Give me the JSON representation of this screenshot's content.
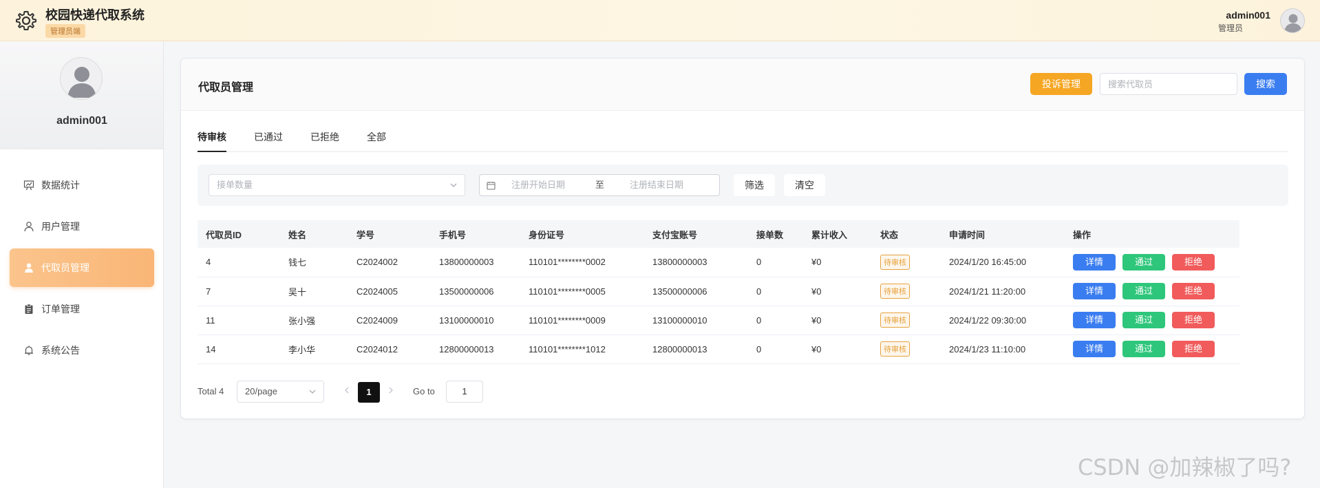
{
  "header": {
    "app_title": "校园快递代取系统",
    "role_badge": "管理员端",
    "user_name": "admin001",
    "user_role": "管理员"
  },
  "sidebar": {
    "profile_name": "admin001",
    "items": [
      {
        "label": "数据统计",
        "icon": "presentation-chart-icon",
        "active": false
      },
      {
        "label": "用户管理",
        "icon": "user-icon",
        "active": false
      },
      {
        "label": "代取员管理",
        "icon": "user-filled-icon",
        "active": true
      },
      {
        "label": "订单管理",
        "icon": "clipboard-icon",
        "active": false
      },
      {
        "label": "系统公告",
        "icon": "bell-icon",
        "active": false
      }
    ]
  },
  "main": {
    "title": "代取员管理",
    "complaint_button": "投诉管理",
    "search_placeholder": "搜索代取员",
    "search_button": "搜索",
    "tabs": [
      {
        "label": "待审核",
        "active": true
      },
      {
        "label": "已通过",
        "active": false
      },
      {
        "label": "已拒绝",
        "active": false
      },
      {
        "label": "全部",
        "active": false
      }
    ],
    "filter": {
      "order_count_placeholder": "接单数量",
      "date_start_placeholder": "注册开始日期",
      "date_separator": "至",
      "date_end_placeholder": "注册结束日期",
      "filter_button": "筛选",
      "clear_button": "清空"
    },
    "table": {
      "columns": [
        "代取员ID",
        "姓名",
        "学号",
        "手机号",
        "身份证号",
        "支付宝账号",
        "接单数",
        "累计收入",
        "状态",
        "申请时间",
        "操作"
      ],
      "rows": [
        {
          "id": "4",
          "name": "钱七",
          "student_no": "C2024002",
          "phone": "13800000003",
          "id_card": "110101********0002",
          "alipay": "13800000003",
          "orders": "0",
          "income": "¥0",
          "status": "待审核",
          "apply_time": "2024/1/20 16:45:00"
        },
        {
          "id": "7",
          "name": "吴十",
          "student_no": "C2024005",
          "phone": "13500000006",
          "id_card": "110101********0005",
          "alipay": "13500000006",
          "orders": "0",
          "income": "¥0",
          "status": "待审核",
          "apply_time": "2024/1/21 11:20:00"
        },
        {
          "id": "11",
          "name": "张小强",
          "student_no": "C2024009",
          "phone": "13100000010",
          "id_card": "110101********0009",
          "alipay": "13100000010",
          "orders": "0",
          "income": "¥0",
          "status": "待审核",
          "apply_time": "2024/1/22 09:30:00"
        },
        {
          "id": "14",
          "name": "李小华",
          "student_no": "C2024012",
          "phone": "12800000013",
          "id_card": "110101********1012",
          "alipay": "12800000013",
          "orders": "0",
          "income": "¥0",
          "status": "待审核",
          "apply_time": "2024/1/23 11:10:00"
        }
      ],
      "actions": {
        "detail": "详情",
        "pass": "通过",
        "reject": "拒绝"
      }
    },
    "pagination": {
      "total": "Total 4",
      "page_size": "20/page",
      "current_page": "1",
      "goto_label": "Go to",
      "goto_value": "1"
    }
  },
  "watermark": "CSDN @加辣椒了吗?",
  "colors": {
    "accent_orange": "#f5a623",
    "primary_blue": "#3a7df0",
    "success_green": "#2ec67a",
    "danger_red": "#f15b5b",
    "warning_tag": "#e6a23c"
  }
}
